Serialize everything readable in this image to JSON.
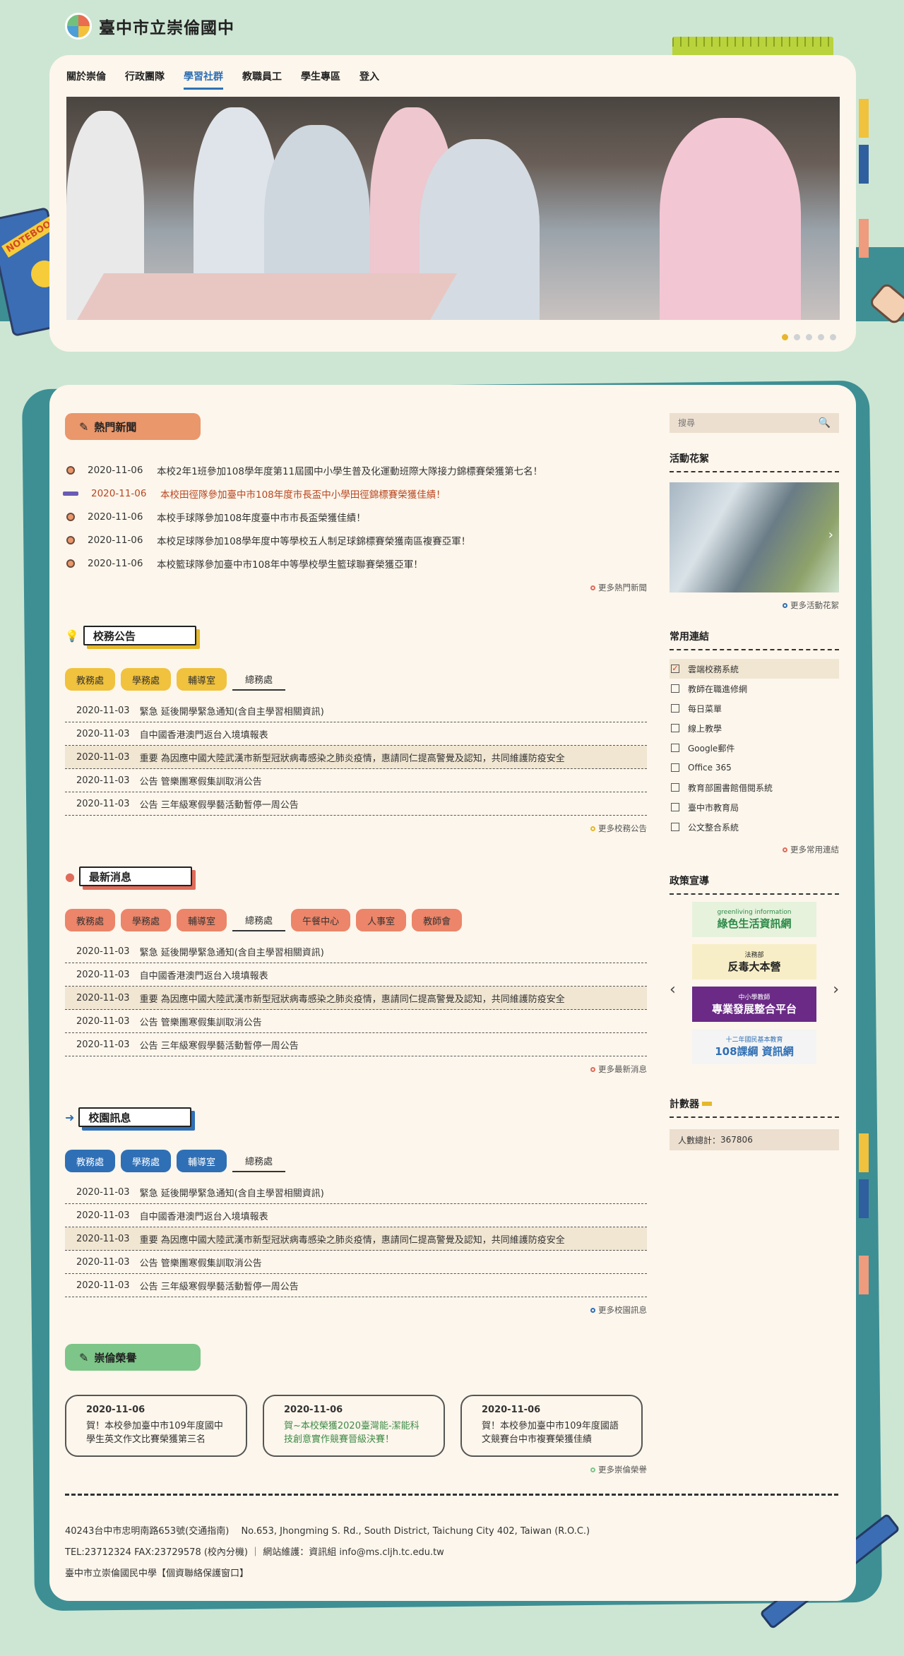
{
  "site": {
    "title": "臺中市立崇倫國中"
  },
  "nav": [
    "關於崇倫",
    "行政團隊",
    "學習社群",
    "教職員工",
    "學生專區",
    "登入"
  ],
  "nav_active": 2,
  "decor": {
    "notebook_label": "NOTEBOOK"
  },
  "hot_news": {
    "title": "熱門新聞",
    "items": [
      {
        "date": "2020-11-06",
        "text": "本校2年1班參加108學年度第11屆國中小學生普及化運動班際大隊接力錦標賽榮獲第七名！"
      },
      {
        "date": "2020-11-06",
        "text": "本校田徑隊參加臺中市108年度市長盃中小學田徑錦標賽榮獲佳績！"
      },
      {
        "date": "2020-11-06",
        "text": "本校手球隊參加108年度臺中市市長盃榮獲佳績！"
      },
      {
        "date": "2020-11-06",
        "text": "本校足球隊參加108學年度中等學校五人制足球錦標賽榮獲南區複賽亞軍！"
      },
      {
        "date": "2020-11-06",
        "text": "本校籃球隊參加臺中市108年中等學校學生籃球聯賽榮獲亞軍！"
      }
    ],
    "more": "更多熱門新聞"
  },
  "announcements": {
    "title": "校務公告",
    "tabs": [
      "教務處",
      "學務處",
      "輔導室",
      "總務處"
    ],
    "rows": [
      {
        "date": "2020-11-03",
        "text": "緊急 延後開學緊急通知(含自主學習相關資訊)"
      },
      {
        "date": "2020-11-03",
        "text": "自中國香港澳門返台入境填報表"
      },
      {
        "date": "2020-11-03",
        "text": "重要 為因應中國大陸武漢市新型冠狀病毒感染之肺炎疫情，惠請同仁提高警覺及認知，共同維護防疫安全"
      },
      {
        "date": "2020-11-03",
        "text": "公告 管樂團寒假集訓取消公告"
      },
      {
        "date": "2020-11-03",
        "text": "公告 三年級寒假學藝活動暫停一周公告"
      }
    ],
    "more": "更多校務公告"
  },
  "latest": {
    "title": "最新消息",
    "tabs": [
      "教務處",
      "學務處",
      "輔導室",
      "總務處",
      "午餐中心",
      "人事室",
      "教師會"
    ],
    "rows": [
      {
        "date": "2020-11-03",
        "text": "緊急 延後開學緊急通知(含自主學習相關資訊)"
      },
      {
        "date": "2020-11-03",
        "text": "自中國香港澳門返台入境填報表"
      },
      {
        "date": "2020-11-03",
        "text": "重要 為因應中國大陸武漢市新型冠狀病毒感染之肺炎疫情，惠請同仁提高警覺及認知，共同維護防疫安全"
      },
      {
        "date": "2020-11-03",
        "text": "公告 管樂團寒假集訓取消公告"
      },
      {
        "date": "2020-11-03",
        "text": "公告 三年級寒假學藝活動暫停一周公告"
      }
    ],
    "more": "更多最新消息"
  },
  "campus": {
    "title": "校園訊息",
    "tabs": [
      "教務處",
      "學務處",
      "輔導室",
      "總務處"
    ],
    "rows": [
      {
        "date": "2020-11-03",
        "text": "緊急 延後開學緊急通知(含自主學習相關資訊)"
      },
      {
        "date": "2020-11-03",
        "text": "自中國香港澳門返台入境填報表"
      },
      {
        "date": "2020-11-03",
        "text": "重要 為因應中國大陸武漢市新型冠狀病毒感染之肺炎疫情，惠請同仁提高警覺及認知，共同維護防疫安全"
      },
      {
        "date": "2020-11-03",
        "text": "公告 管樂團寒假集訓取消公告"
      },
      {
        "date": "2020-11-03",
        "text": "公告 三年級寒假學藝活動暫停一周公告"
      }
    ],
    "more": "更多校園訊息"
  },
  "honors": {
    "title": "崇倫榮譽",
    "cards": [
      {
        "date": "2020-11-06",
        "text": "賀！本校參加臺中市109年度國中學生英文作文比賽榮獲第三名"
      },
      {
        "date": "2020-11-06",
        "text": "賀~本校榮獲2020臺灣能-潔能科技創意實作競賽晉級決賽！"
      },
      {
        "date": "2020-11-06",
        "text": "賀！本校參加臺中市109年度國語文競賽台中市複賽榮獲佳績"
      }
    ],
    "more": "更多崇倫榮譽"
  },
  "sidebar": {
    "search_placeholder": "搜尋",
    "gallery_title": "活動花絮",
    "gallery_more": "更多活動花絮",
    "links_title": "常用連結",
    "links": [
      "雲端校務系統",
      "教師在職進修網",
      "每日菜單",
      "線上教學",
      "Google郵件",
      "Office 365",
      "教育部圖書館借閱系統",
      "臺中市教育局",
      "公文整合系統"
    ],
    "links_more": "更多常用連結",
    "policy_title": "政策宣導",
    "policy_banners": [
      {
        "text": "綠色生活資訊網",
        "sub": "greenliving information",
        "color": "#2e8b4a",
        "bg": "#e6f2dc"
      },
      {
        "text": "反毒大本營",
        "sub": "法務部",
        "color": "#222",
        "bg": "#f7eec7"
      },
      {
        "text": "專業發展整合平台",
        "sub": "中小學教師",
        "color": "#fff",
        "bg": "#6a2a86"
      },
      {
        "text": "108課綱 資訊網",
        "sub": "十二年國民基本教育",
        "color": "#2f6fb5",
        "bg": "#f4f4f4"
      }
    ],
    "counter_title": "計數器",
    "counter_label": "人數總計：",
    "counter_value": "367806"
  },
  "footer": {
    "address": "40243台中市忠明南路653號(交通指南)　 No.653, Jhongming S. Rd., South District, Taichung City 402, Taiwan (R.O.C.)",
    "contact": "TEL:23712324 FAX:23729578 (校內分機) ｜ 網站維護：資訊組 info@ms.cljh.tc.edu.tw",
    "privacy": "臺中市立崇倫國民中學【個資聯絡保護窗口】"
  },
  "colors": {
    "accent_blue": "#2f6fb5",
    "hot": "#e9976b",
    "honor": "#7dc588",
    "teal": "#3d8f94"
  }
}
